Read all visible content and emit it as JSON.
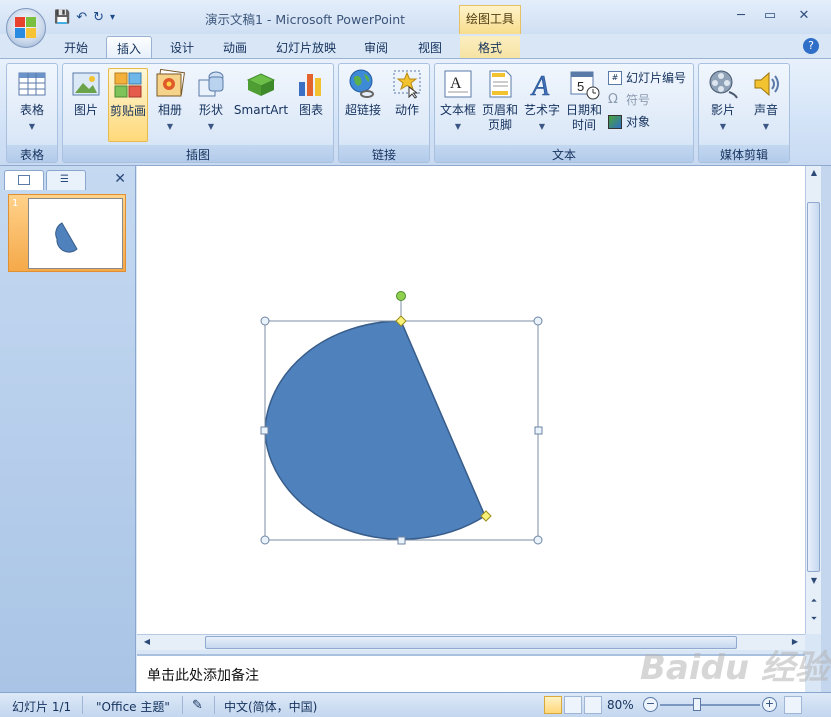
{
  "window": {
    "title": "演示文稿1 - Microsoft PowerPoint",
    "context_tools": "绘图工具"
  },
  "tabs": [
    {
      "label": "开始"
    },
    {
      "label": "插入"
    },
    {
      "label": "设计"
    },
    {
      "label": "动画"
    },
    {
      "label": "幻灯片放映"
    },
    {
      "label": "审阅"
    },
    {
      "label": "视图"
    },
    {
      "label": "格式"
    }
  ],
  "ribbon": {
    "groups": {
      "table": "表格",
      "illustrations": "插图",
      "links": "链接",
      "text": "文本",
      "media": "媒体剪辑"
    },
    "buttons": {
      "table": "表格",
      "picture": "图片",
      "clipart": "剪贴画",
      "album": "相册",
      "shapes": "形状",
      "smartart": "SmartArt",
      "chart": "图表",
      "hyperlink": "超链接",
      "action": "动作",
      "textbox": "文本框",
      "header_footer_1": "页眉和",
      "header_footer_2": "页脚",
      "wordart": "艺术字",
      "datetime_1": "日期和",
      "datetime_2": "时间",
      "slide_number": "幻灯片编号",
      "symbol": "符号",
      "object": "对象",
      "movie": "影片",
      "sound": "声音"
    }
  },
  "thumbnail": {
    "number": "1"
  },
  "notes": {
    "placeholder": "单击此处添加备注"
  },
  "status": {
    "slide": "幻灯片 1/1",
    "theme": "\"Office 主题\"",
    "language": "中文(简体，中国)",
    "zoom": "80%"
  },
  "colors": {
    "shape_fill": "#4f81bd",
    "shape_stroke": "#385d8a"
  },
  "watermark": "Baidu 经验"
}
